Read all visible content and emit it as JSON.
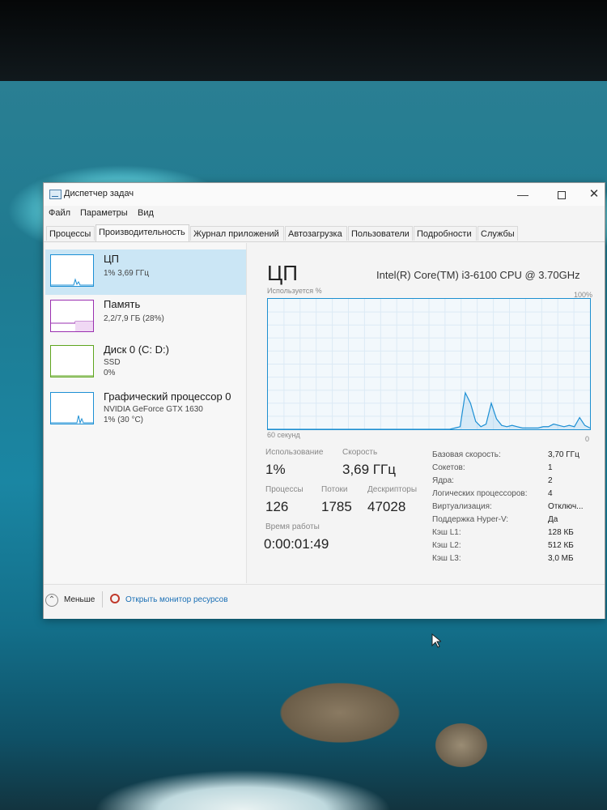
{
  "window": {
    "title": "Диспетчер задач",
    "controls": {
      "minimize": "—",
      "close": "✕"
    }
  },
  "menu": [
    "Файл",
    "Параметры",
    "Вид"
  ],
  "tabs": [
    "Процессы",
    "Производительность",
    "Журнал приложений",
    "Автозагрузка",
    "Пользователи",
    "Подробности",
    "Службы"
  ],
  "active_tab": "Производительность",
  "resources": [
    {
      "title": "ЦП",
      "line1": "1% 3,69 ГГц",
      "line2": "",
      "color": "#1c8fd4",
      "selected": true
    },
    {
      "title": "Память",
      "line1": "2,2/7,9 ГБ (28%)",
      "line2": "",
      "color": "#9a2fb0",
      "selected": false
    },
    {
      "title": "Диск 0 (C: D:)",
      "line1": "SSD",
      "line2": "0%",
      "color": "#5ea51e",
      "selected": false
    },
    {
      "title": "Графический процессор 0",
      "line1": "NVIDIA GeForce GTX 1630",
      "line2": "1% (30 °C)",
      "color": "#1c8fd4",
      "selected": false
    }
  ],
  "cpu": {
    "heading": "ЦП",
    "model": "Intel(R) Core(TM) i3-6100 CPU @ 3.70GHz",
    "graph": {
      "usage_label": "Используется %",
      "max_label": "100%",
      "time_label": "60 секунд",
      "zero_label": "0",
      "usage_percent_samples": [
        0,
        0,
        0,
        0,
        0,
        0,
        0,
        0,
        0,
        0,
        0,
        0,
        0,
        0,
        0,
        0,
        0,
        0,
        0,
        0,
        0,
        0,
        0,
        0,
        0,
        0,
        0,
        0,
        0,
        0,
        0,
        0,
        0,
        0,
        0,
        0,
        1,
        2,
        28,
        20,
        6,
        2,
        4,
        20,
        8,
        3,
        2,
        3,
        2,
        1,
        1,
        1,
        1,
        2,
        2,
        4,
        3,
        2,
        3,
        2,
        9,
        3,
        1
      ]
    },
    "stats": {
      "utilization_label": "Использование",
      "utilization": "1%",
      "speed_label": "Скорость",
      "speed": "3,69 ГГц",
      "processes_label": "Процессы",
      "processes": "126",
      "threads_label": "Потоки",
      "threads": "1785",
      "handles_label": "Дескрипторы",
      "handles": "47028",
      "uptime_label": "Время работы",
      "uptime": "0:00:01:49"
    },
    "info": [
      {
        "key": "Базовая скорость:",
        "value": "3,70 ГГц"
      },
      {
        "key": "Сокетов:",
        "value": "1"
      },
      {
        "key": "Ядра:",
        "value": "2"
      },
      {
        "key": "Логических процессоров:",
        "value": "4"
      },
      {
        "key": "Виртуализация:",
        "value": "Отключ..."
      },
      {
        "key": "Поддержка Hyper-V:",
        "value": "Да"
      },
      {
        "key": "Кэш L1:",
        "value": "128 КБ"
      },
      {
        "key": "Кэш L2:",
        "value": "512 КБ"
      },
      {
        "key": "Кэш L3:",
        "value": "3,0 МБ"
      }
    ]
  },
  "footer": {
    "less_label": "Меньше",
    "monitor_link": "Открыть монитор ресурсов"
  }
}
